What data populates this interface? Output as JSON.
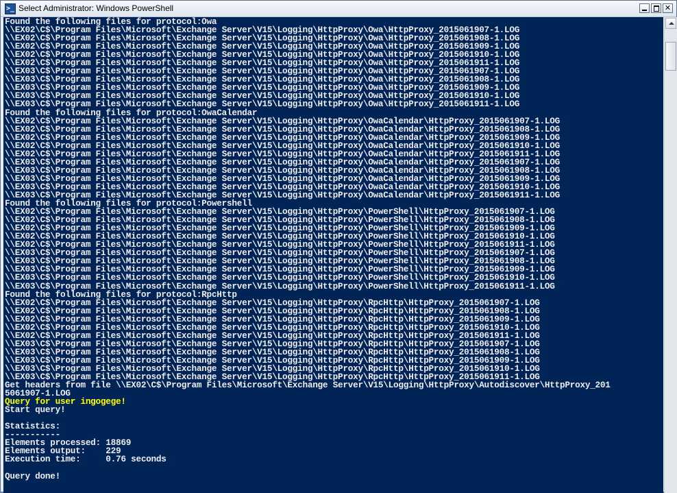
{
  "window": {
    "title": "Select Administrator: Windows PowerShell",
    "icon_glyph": ">_",
    "controls": {
      "minimize": "minimize-icon",
      "maximize": "maximize-icon",
      "close": "✕"
    }
  },
  "console": {
    "background": "#012456",
    "foreground": "#eeedf0",
    "highlight": "#ffff00",
    "lines": [
      {
        "text": "Found the following files for protocol:Owa",
        "color": "default"
      },
      {
        "text": "\\\\EX02\\C$\\Program Files\\Microsoft\\Exchange Server\\V15\\Logging\\HttpProxy\\Owa\\HttpProxy_2015061907-1.LOG",
        "color": "default"
      },
      {
        "text": "\\\\EX02\\C$\\Program Files\\Microsoft\\Exchange Server\\V15\\Logging\\HttpProxy\\Owa\\HttpProxy_2015061908-1.LOG",
        "color": "default"
      },
      {
        "text": "\\\\EX02\\C$\\Program Files\\Microsoft\\Exchange Server\\V15\\Logging\\HttpProxy\\Owa\\HttpProxy_2015061909-1.LOG",
        "color": "default"
      },
      {
        "text": "\\\\EX02\\C$\\Program Files\\Microsoft\\Exchange Server\\V15\\Logging\\HttpProxy\\Owa\\HttpProxy_2015061910-1.LOG",
        "color": "default"
      },
      {
        "text": "\\\\EX02\\C$\\Program Files\\Microsoft\\Exchange Server\\V15\\Logging\\HttpProxy\\Owa\\HttpProxy_2015061911-1.LOG",
        "color": "default"
      },
      {
        "text": "\\\\EX03\\C$\\Program Files\\Microsoft\\Exchange Server\\V15\\Logging\\HttpProxy\\Owa\\HttpProxy_2015061907-1.LOG",
        "color": "default"
      },
      {
        "text": "\\\\EX03\\C$\\Program Files\\Microsoft\\Exchange Server\\V15\\Logging\\HttpProxy\\Owa\\HttpProxy_2015061908-1.LOG",
        "color": "default"
      },
      {
        "text": "\\\\EX03\\C$\\Program Files\\Microsoft\\Exchange Server\\V15\\Logging\\HttpProxy\\Owa\\HttpProxy_2015061909-1.LOG",
        "color": "default"
      },
      {
        "text": "\\\\EX03\\C$\\Program Files\\Microsoft\\Exchange Server\\V15\\Logging\\HttpProxy\\Owa\\HttpProxy_2015061910-1.LOG",
        "color": "default"
      },
      {
        "text": "\\\\EX03\\C$\\Program Files\\Microsoft\\Exchange Server\\V15\\Logging\\HttpProxy\\Owa\\HttpProxy_2015061911-1.LOG",
        "color": "default"
      },
      {
        "text": "Found the following files for protocol:OwaCalendar",
        "color": "default"
      },
      {
        "text": "\\\\EX02\\C$\\Program Files\\Microsoft\\Exchange Server\\V15\\Logging\\HttpProxy\\OwaCalendar\\HttpProxy_2015061907-1.LOG",
        "color": "default"
      },
      {
        "text": "\\\\EX02\\C$\\Program Files\\Microsoft\\Exchange Server\\V15\\Logging\\HttpProxy\\OwaCalendar\\HttpProxy_2015061908-1.LOG",
        "color": "default"
      },
      {
        "text": "\\\\EX02\\C$\\Program Files\\Microsoft\\Exchange Server\\V15\\Logging\\HttpProxy\\OwaCalendar\\HttpProxy_2015061909-1.LOG",
        "color": "default"
      },
      {
        "text": "\\\\EX02\\C$\\Program Files\\Microsoft\\Exchange Server\\V15\\Logging\\HttpProxy\\OwaCalendar\\HttpProxy_2015061910-1.LOG",
        "color": "default"
      },
      {
        "text": "\\\\EX02\\C$\\Program Files\\Microsoft\\Exchange Server\\V15\\Logging\\HttpProxy\\OwaCalendar\\HttpProxy_2015061911-1.LOG",
        "color": "default"
      },
      {
        "text": "\\\\EX03\\C$\\Program Files\\Microsoft\\Exchange Server\\V15\\Logging\\HttpProxy\\OwaCalendar\\HttpProxy_2015061907-1.LOG",
        "color": "default"
      },
      {
        "text": "\\\\EX03\\C$\\Program Files\\Microsoft\\Exchange Server\\V15\\Logging\\HttpProxy\\OwaCalendar\\HttpProxy_2015061908-1.LOG",
        "color": "default"
      },
      {
        "text": "\\\\EX03\\C$\\Program Files\\Microsoft\\Exchange Server\\V15\\Logging\\HttpProxy\\OwaCalendar\\HttpProxy_2015061909-1.LOG",
        "color": "default"
      },
      {
        "text": "\\\\EX03\\C$\\Program Files\\Microsoft\\Exchange Server\\V15\\Logging\\HttpProxy\\OwaCalendar\\HttpProxy_2015061910-1.LOG",
        "color": "default"
      },
      {
        "text": "\\\\EX03\\C$\\Program Files\\Microsoft\\Exchange Server\\V15\\Logging\\HttpProxy\\OwaCalendar\\HttpProxy_2015061911-1.LOG",
        "color": "default"
      },
      {
        "text": "Found the following files for protocol:Powershell",
        "color": "default"
      },
      {
        "text": "\\\\EX02\\C$\\Program Files\\Microsoft\\Exchange Server\\V15\\Logging\\HttpProxy\\PowerShell\\HttpProxy_2015061907-1.LOG",
        "color": "default"
      },
      {
        "text": "\\\\EX02\\C$\\Program Files\\Microsoft\\Exchange Server\\V15\\Logging\\HttpProxy\\PowerShell\\HttpProxy_2015061908-1.LOG",
        "color": "default"
      },
      {
        "text": "\\\\EX02\\C$\\Program Files\\Microsoft\\Exchange Server\\V15\\Logging\\HttpProxy\\PowerShell\\HttpProxy_2015061909-1.LOG",
        "color": "default"
      },
      {
        "text": "\\\\EX02\\C$\\Program Files\\Microsoft\\Exchange Server\\V15\\Logging\\HttpProxy\\PowerShell\\HttpProxy_2015061910-1.LOG",
        "color": "default"
      },
      {
        "text": "\\\\EX02\\C$\\Program Files\\Microsoft\\Exchange Server\\V15\\Logging\\HttpProxy\\PowerShell\\HttpProxy_2015061911-1.LOG",
        "color": "default"
      },
      {
        "text": "\\\\EX03\\C$\\Program Files\\Microsoft\\Exchange Server\\V15\\Logging\\HttpProxy\\PowerShell\\HttpProxy_2015061907-1.LOG",
        "color": "default"
      },
      {
        "text": "\\\\EX03\\C$\\Program Files\\Microsoft\\Exchange Server\\V15\\Logging\\HttpProxy\\PowerShell\\HttpProxy_2015061908-1.LOG",
        "color": "default"
      },
      {
        "text": "\\\\EX03\\C$\\Program Files\\Microsoft\\Exchange Server\\V15\\Logging\\HttpProxy\\PowerShell\\HttpProxy_2015061909-1.LOG",
        "color": "default"
      },
      {
        "text": "\\\\EX03\\C$\\Program Files\\Microsoft\\Exchange Server\\V15\\Logging\\HttpProxy\\PowerShell\\HttpProxy_2015061910-1.LOG",
        "color": "default"
      },
      {
        "text": "\\\\EX03\\C$\\Program Files\\Microsoft\\Exchange Server\\V15\\Logging\\HttpProxy\\PowerShell\\HttpProxy_2015061911-1.LOG",
        "color": "default"
      },
      {
        "text": "Found the following files for protocol:RpcHttp",
        "color": "default"
      },
      {
        "text": "\\\\EX02\\C$\\Program Files\\Microsoft\\Exchange Server\\V15\\Logging\\HttpProxy\\RpcHttp\\HttpProxy_2015061907-1.LOG",
        "color": "default"
      },
      {
        "text": "\\\\EX02\\C$\\Program Files\\Microsoft\\Exchange Server\\V15\\Logging\\HttpProxy\\RpcHttp\\HttpProxy_2015061908-1.LOG",
        "color": "default"
      },
      {
        "text": "\\\\EX02\\C$\\Program Files\\Microsoft\\Exchange Server\\V15\\Logging\\HttpProxy\\RpcHttp\\HttpProxy_2015061909-1.LOG",
        "color": "default"
      },
      {
        "text": "\\\\EX02\\C$\\Program Files\\Microsoft\\Exchange Server\\V15\\Logging\\HttpProxy\\RpcHttp\\HttpProxy_2015061910-1.LOG",
        "color": "default"
      },
      {
        "text": "\\\\EX02\\C$\\Program Files\\Microsoft\\Exchange Server\\V15\\Logging\\HttpProxy\\RpcHttp\\HttpProxy_2015061911-1.LOG",
        "color": "default"
      },
      {
        "text": "\\\\EX03\\C$\\Program Files\\Microsoft\\Exchange Server\\V15\\Logging\\HttpProxy\\RpcHttp\\HttpProxy_2015061907-1.LOG",
        "color": "default"
      },
      {
        "text": "\\\\EX03\\C$\\Program Files\\Microsoft\\Exchange Server\\V15\\Logging\\HttpProxy\\RpcHttp\\HttpProxy_2015061908-1.LOG",
        "color": "default"
      },
      {
        "text": "\\\\EX03\\C$\\Program Files\\Microsoft\\Exchange Server\\V15\\Logging\\HttpProxy\\RpcHttp\\HttpProxy_2015061909-1.LOG",
        "color": "default"
      },
      {
        "text": "\\\\EX03\\C$\\Program Files\\Microsoft\\Exchange Server\\V15\\Logging\\HttpProxy\\RpcHttp\\HttpProxy_2015061910-1.LOG",
        "color": "default"
      },
      {
        "text": "\\\\EX03\\C$\\Program Files\\Microsoft\\Exchange Server\\V15\\Logging\\HttpProxy\\RpcHttp\\HttpProxy_2015061911-1.LOG",
        "color": "default"
      },
      {
        "text": "Get headers from file \\\\EX02\\C$\\Program Files\\Microsoft\\Exchange Server\\V15\\Logging\\HttpProxy\\Autodiscover\\HttpProxy_201",
        "color": "default"
      },
      {
        "text": "5061907-1.LOG",
        "color": "default"
      },
      {
        "text": "Query for user ingogege!",
        "color": "yellow"
      },
      {
        "text": "Start query!",
        "color": "default"
      },
      {
        "text": "",
        "color": "default"
      },
      {
        "text": "Statistics:",
        "color": "default"
      },
      {
        "text": "-----------",
        "color": "default"
      },
      {
        "text": "Elements processed: 18869",
        "color": "default"
      },
      {
        "text": "Elements output:    229",
        "color": "default"
      },
      {
        "text": "Execution time:     0.76 seconds",
        "color": "default"
      },
      {
        "text": "",
        "color": "default"
      },
      {
        "text": "Query done!",
        "color": "default"
      }
    ]
  },
  "scrollbar": {
    "up_arrow": "scroll-up-arrow-icon",
    "thumb_position": 0.05
  }
}
